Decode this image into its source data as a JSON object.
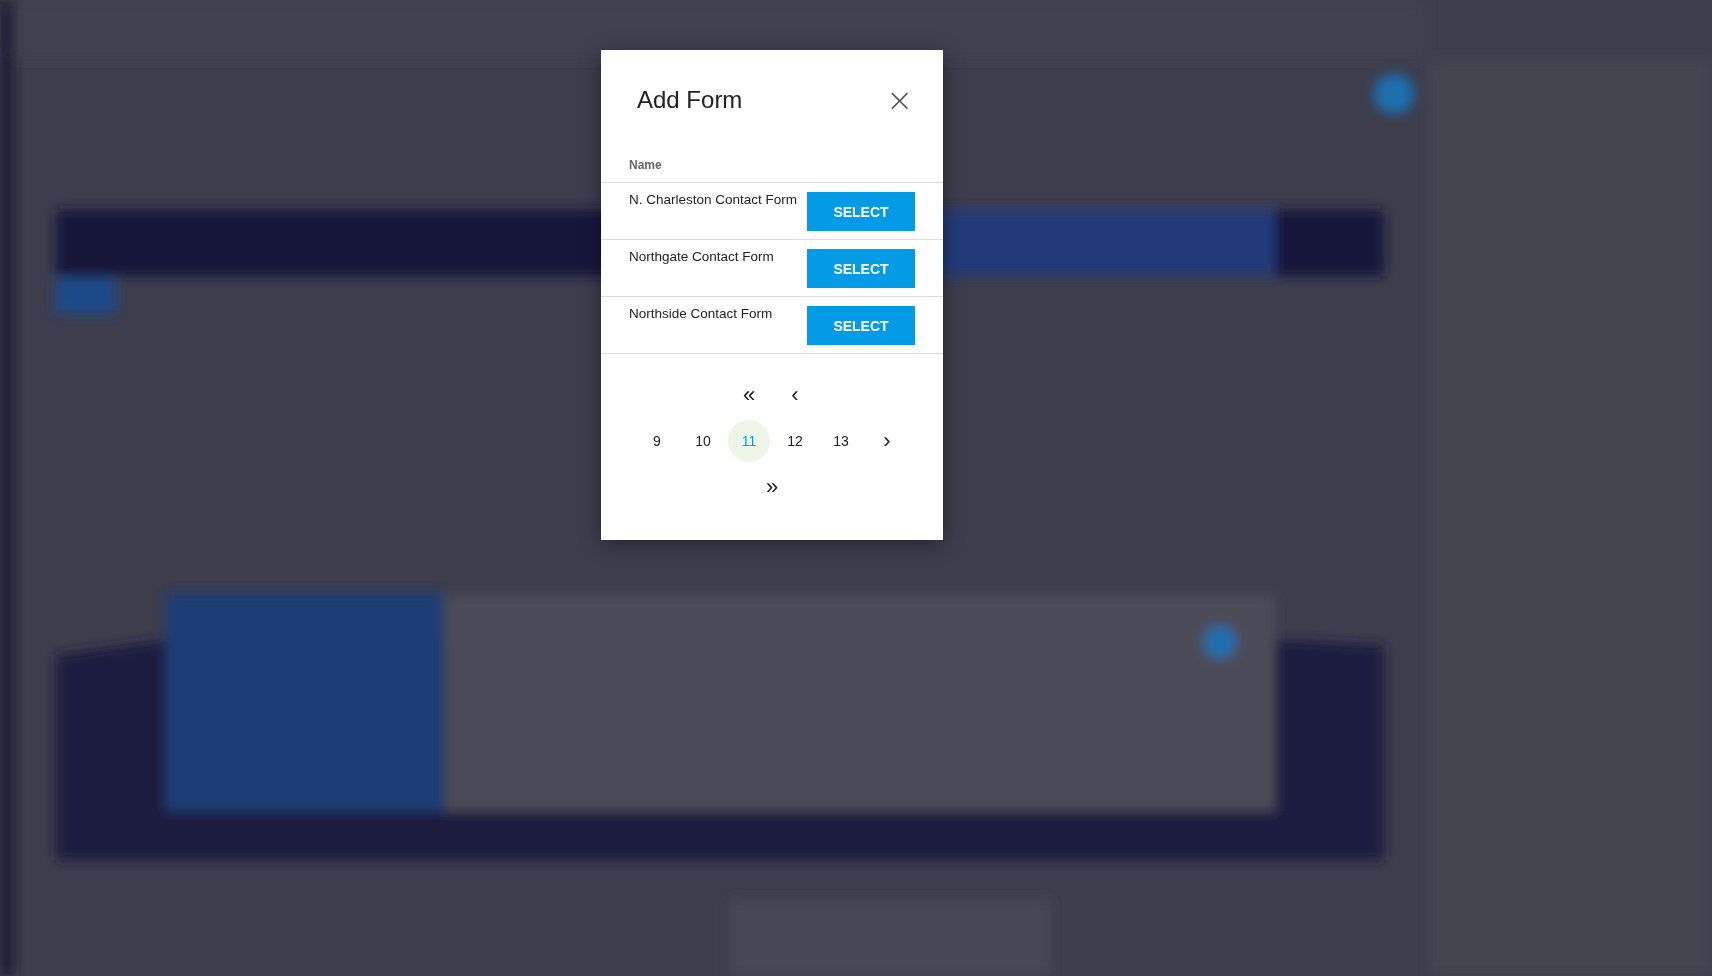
{
  "dialog": {
    "title": "Add Form",
    "close_label": "×",
    "table": {
      "columns": [
        "Name"
      ],
      "rows": [
        {
          "name": "N. Charleston Contact Form",
          "action": "SELECT"
        },
        {
          "name": "Northgate Contact Form",
          "action": "SELECT"
        },
        {
          "name": "Northside Contact Form",
          "action": "SELECT"
        }
      ]
    },
    "pagination": {
      "first": "«",
      "prev": "‹",
      "next": "›",
      "last": "»",
      "pages": [
        {
          "label": "9",
          "selected": false
        },
        {
          "label": "10",
          "selected": false
        },
        {
          "label": "11",
          "selected": true
        },
        {
          "label": "12",
          "selected": false
        },
        {
          "label": "13",
          "selected": false
        }
      ]
    }
  }
}
